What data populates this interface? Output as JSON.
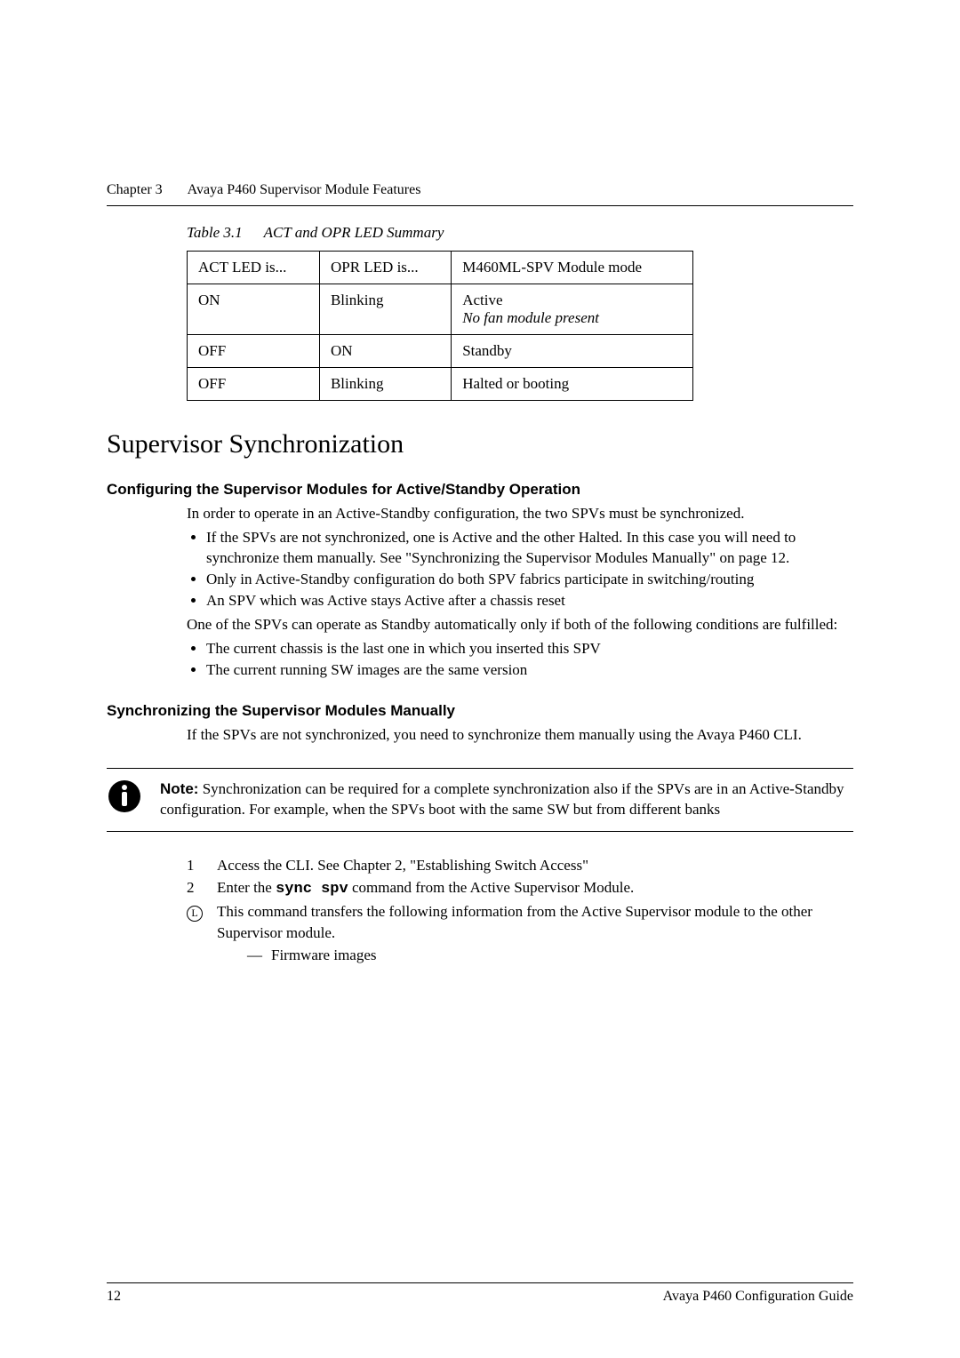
{
  "header": {
    "chapter": "Chapter 3",
    "title": "Avaya P460 Supervisor Module Features"
  },
  "tableCaption": {
    "label": "Table 3.1",
    "title": "ACT and OPR LED Summary"
  },
  "table": {
    "headers": [
      "ACT LED is...",
      "OPR LED is...",
      "M460ML-SPV Module mode"
    ],
    "rows": [
      {
        "c0": "ON",
        "c1": "Blinking",
        "c2a": "Active",
        "c2b": "No fan module present"
      },
      {
        "c0": "OFF",
        "c1": "ON",
        "c2a": "Standby",
        "c2b": ""
      },
      {
        "c0": "OFF",
        "c1": "Blinking",
        "c2a": "Halted or booting",
        "c2b": ""
      }
    ]
  },
  "sectionTitle": "Supervisor Synchronization",
  "sub1": {
    "title": "Configuring the Supervisor Modules for Active/Standby Operation",
    "p1": "In order to operate in an Active-Standby configuration, the two SPVs must be synchronized.",
    "bullets1": [
      "If the SPVs are not synchronized, one is Active and the other Halted. In this case you will need to synchronize them manually. See \"Synchronizing the Supervisor Modules Manually\" on page 12.",
      "Only in Active-Standby configuration do both SPV fabrics participate in switching/routing",
      "An SPV which was Active stays Active after a chassis reset"
    ],
    "p2": "One of the SPVs can operate as Standby automatically only if both of the following conditions are fulfilled:",
    "bullets2": [
      "The current chassis is the last one in which you inserted this SPV",
      "The current running SW images are the same version"
    ]
  },
  "sub2": {
    "title": "Synchronizing the Supervisor Modules Manually",
    "p1": "If the SPVs are not synchronized, you need to synchronize them manually using the Avaya P460 CLI."
  },
  "note": {
    "label": "Note:",
    "text": "Synchronization can be required for a complete synchronization also if the SPVs are in an Active-Standby configuration. For example, when the SPVs boot with the same SW but from different banks"
  },
  "steps": {
    "s1": {
      "num": "1",
      "text": "Access the CLI. See  Chapter 2, \"Establishing Switch Access\""
    },
    "s2": {
      "num": "2",
      "pre": "Enter the ",
      "code": "sync spv",
      "post": " command from the Active Supervisor Module."
    },
    "sL": {
      "text": "This command transfers the following information from the Active Supervisor module to the other Supervisor module."
    },
    "dash": "Firmware images"
  },
  "footer": {
    "page": "12",
    "doc": "Avaya P460 Configuration Guide"
  }
}
